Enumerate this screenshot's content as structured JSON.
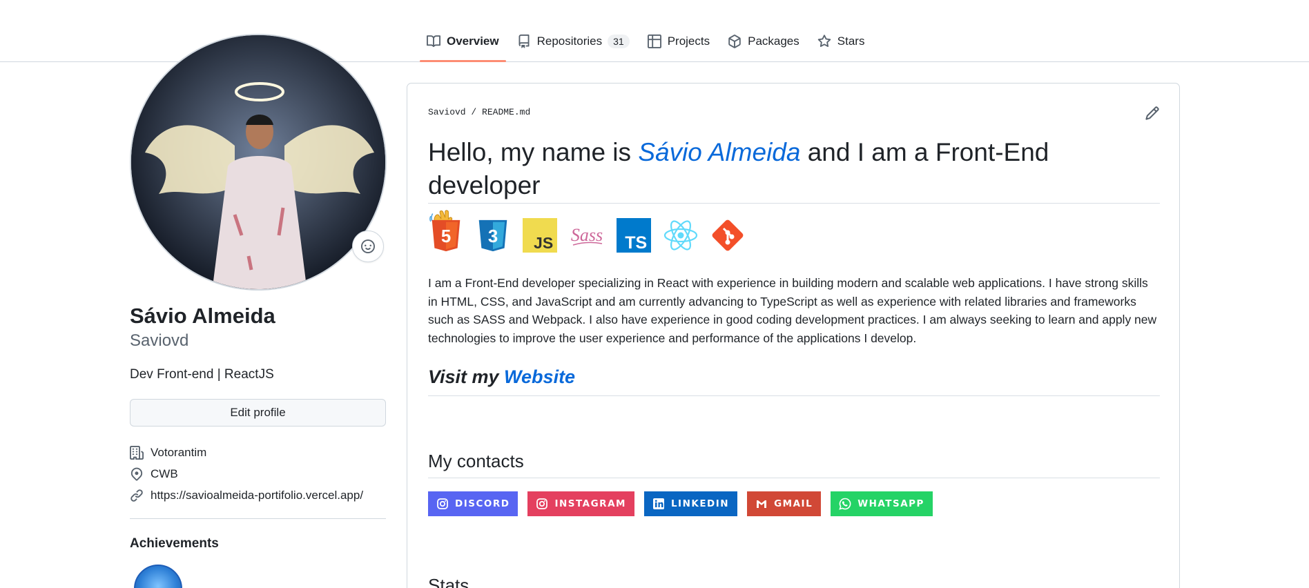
{
  "nav": {
    "tabs": [
      {
        "label": "Overview",
        "icon": "book-icon"
      },
      {
        "label": "Repositories",
        "icon": "repo-icon",
        "count": "31"
      },
      {
        "label": "Projects",
        "icon": "table-icon"
      },
      {
        "label": "Packages",
        "icon": "package-icon"
      },
      {
        "label": "Stars",
        "icon": "star-icon"
      }
    ]
  },
  "profile": {
    "full_name": "Sávio Almeida",
    "username": "Saviovd",
    "bio": "Dev Front-end | ReactJS",
    "edit_label": "Edit profile",
    "company": "Votorantim",
    "location": "CWB",
    "website": "https://savioalmeida-portifolio.vercel.app/",
    "achievements_title": "Achievements"
  },
  "readme": {
    "owner": "Saviovd",
    "separator": "/",
    "file": "README.md",
    "heading_prefix": "Hello, my name is ",
    "heading_name": "Sávio Almeida",
    "heading_suffix": " and I am a Front-End developer",
    "tech_labels": {
      "html": "5",
      "css": "3",
      "js": "JS",
      "sass": "Sass",
      "ts": "TS"
    },
    "paragraph": "I am a Front-End developer specializing in React with experience in building modern and scalable web applications. I have strong skills in HTML, CSS, and JavaScript and am currently advancing to TypeScript as well as experience with related libraries and frameworks such as SASS and Webpack. I also have experience in good coding development practices. I am always seeking to learn and apply new technologies to improve the user experience and performance of the applications I develop.",
    "visit_prefix": "Visit my ",
    "visit_link": "Website",
    "contacts_title": "My contacts",
    "contacts": [
      {
        "label": "DISCORD",
        "color": "#5865f2",
        "icon": "discord-icon"
      },
      {
        "label": "INSTAGRAM",
        "color": "#e4405f",
        "icon": "instagram-icon"
      },
      {
        "label": "LINKEDIN",
        "color": "#0a66c2",
        "icon": "linkedin-icon"
      },
      {
        "label": "GMAIL",
        "color": "#d14836",
        "icon": "gmail-icon"
      },
      {
        "label": "WHATSAPP",
        "color": "#25d366",
        "icon": "whatsapp-icon"
      }
    ],
    "stats_title": "Stats"
  },
  "colors": {
    "accent_link": "#0969da",
    "tab_underline": "#fd8c73",
    "border": "#d0d7de"
  }
}
